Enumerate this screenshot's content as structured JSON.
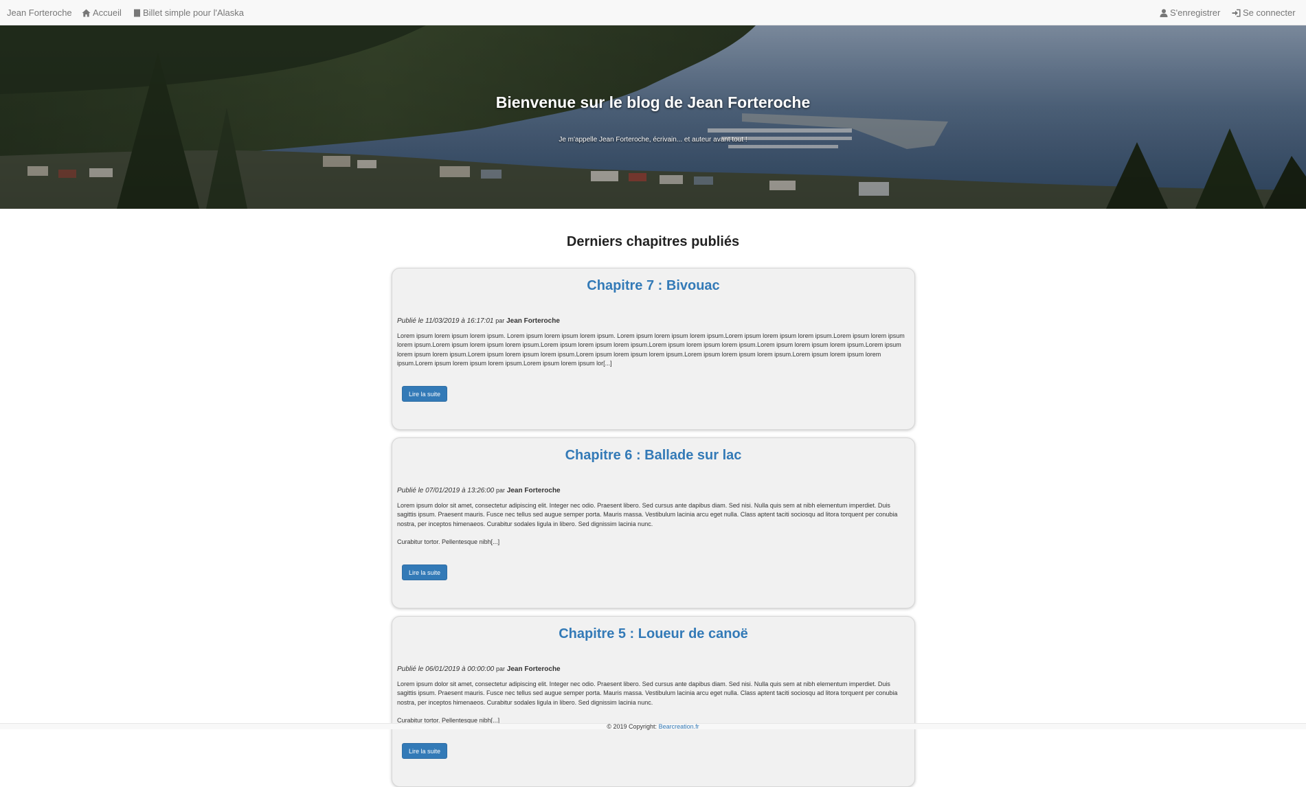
{
  "nav": {
    "brand": "Jean Forteroche",
    "links": [
      {
        "label": "Accueil",
        "icon": "home-icon"
      },
      {
        "label": "Billet simple pour l'Alaska",
        "icon": "book-icon"
      },
      {
        "label": "S'enregistrer",
        "icon": "user-icon"
      },
      {
        "label": "Se connecter",
        "icon": "log-in-icon"
      }
    ]
  },
  "hero": {
    "title": "Bienvenue sur le blog de Jean Forteroche",
    "subtitle": "Je m'appelle Jean Forteroche, écrivain... et auteur avant tout !"
  },
  "main": {
    "heading": "Derniers chapitres publiés",
    "chapters": [
      {
        "title": "Chapitre 7 : Bivouac",
        "meta_prefix": "Publié le 11/03/2019 à 16:17:01",
        "meta_by": "par",
        "author": "Jean Forteroche",
        "excerpt": "Lorem ipsum lorem ipsum lorem ipsum. Lorem ipsum lorem ipsum lorem ipsum. Lorem ipsum lorem ipsum lorem ipsum.Lorem ipsum lorem ipsum lorem ipsum.Lorem ipsum lorem ipsum lorem ipsum.Lorem ipsum lorem ipsum lorem ipsum.Lorem ipsum lorem ipsum lorem ipsum.Lorem ipsum lorem ipsum lorem ipsum.Lorem ipsum lorem ipsum lorem ipsum.Lorem ipsum lorem ipsum lorem ipsum.Lorem ipsum lorem ipsum lorem ipsum.Lorem ipsum lorem ipsum lorem ipsum.Lorem ipsum lorem ipsum lorem ipsum.Lorem ipsum lorem ipsum lorem ipsum.Lorem ipsum lorem ipsum lorem ipsum.Lorem ipsum lorem ipsum lor[...]",
        "button": "Lire la suite"
      },
      {
        "title": "Chapitre 6 : Ballade sur lac",
        "meta_prefix": "Publié le 07/01/2019 à 13:26:00",
        "meta_by": "par",
        "author": "Jean Forteroche",
        "excerpt": "Lorem ipsum dolor sit amet, consectetur adipiscing elit. Integer nec odio. Praesent libero. Sed cursus ante dapibus diam. Sed nisi. Nulla quis sem at nibh elementum imperdiet. Duis sagittis ipsum. Praesent mauris. Fusce nec tellus sed augue semper porta. Mauris massa. Vestibulum lacinia arcu eget nulla. Class aptent taciti sociosqu ad litora torquent per conubia nostra, per inceptos himenaeos. Curabitur sodales ligula in libero. Sed dignissim lacinia nunc.\n\nCurabitur tortor. Pellentesque nibh[...]",
        "button": "Lire la suite"
      },
      {
        "title": "Chapitre 5 : Loueur de canoë",
        "meta_prefix": "Publié le 06/01/2019 à 00:00:00",
        "meta_by": "par",
        "author": "Jean Forteroche",
        "excerpt": "Lorem ipsum dolor sit amet, consectetur adipiscing elit. Integer nec odio. Praesent libero. Sed cursus ante dapibus diam. Sed nisi. Nulla quis sem at nibh elementum imperdiet. Duis sagittis ipsum. Praesent mauris. Fusce nec tellus sed augue semper porta. Mauris massa. Vestibulum lacinia arcu eget nulla. Class aptent taciti sociosqu ad litora torquent per conubia nostra, per inceptos himenaeos. Curabitur sodales ligula in libero. Sed dignissim lacinia nunc.\n\nCurabitur tortor. Pellentesque nibh[...]",
        "button": "Lire la suite"
      }
    ]
  },
  "footer": {
    "text": "© 2019 Copyright:",
    "link": "Bearcreation.fr"
  },
  "colors": {
    "link": "#337ab7",
    "button": "#337ab7",
    "navbar": "#f8f8f8",
    "card": "#f1f1f1"
  }
}
